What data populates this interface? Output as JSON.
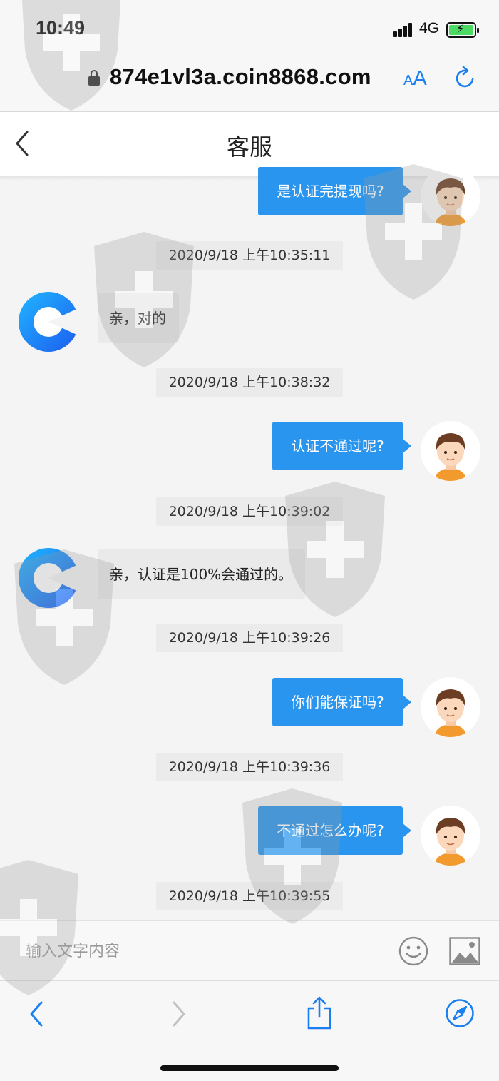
{
  "status_bar": {
    "time": "10:49",
    "network": "4G"
  },
  "address_bar": {
    "url": "874e1vl3a.coin8868.com",
    "text_size_small": "A",
    "text_size_big": "A"
  },
  "header": {
    "title": "客服"
  },
  "messages": [
    {
      "kind": "out",
      "text": "是认证完提现吗?"
    },
    {
      "kind": "time",
      "text": "2020/9/18 上午10:35:11"
    },
    {
      "kind": "in",
      "text": "亲，对的"
    },
    {
      "kind": "time",
      "text": "2020/9/18 上午10:38:32"
    },
    {
      "kind": "out",
      "text": "认证不通过呢?"
    },
    {
      "kind": "time",
      "text": "2020/9/18 上午10:39:02"
    },
    {
      "kind": "in",
      "text": "亲，认证是100%会通过的。"
    },
    {
      "kind": "time",
      "text": "2020/9/18 上午10:39:26"
    },
    {
      "kind": "out",
      "text": "你们能保证吗?"
    },
    {
      "kind": "time",
      "text": "2020/9/18 上午10:39:36"
    },
    {
      "kind": "out",
      "text": "不通过怎么办呢?"
    },
    {
      "kind": "time",
      "text": "2020/9/18 上午10:39:55"
    }
  ],
  "input": {
    "placeholder": "输入文字内容"
  },
  "colors": {
    "accent": "#2a95ee",
    "bubble_in": "#eaeaea",
    "timestamp_bg": "#ebebeb"
  },
  "icons": [
    "lock-icon",
    "reload-icon",
    "back-chevron-icon",
    "emoji-icon",
    "image-icon",
    "share-icon",
    "compass-icon"
  ]
}
